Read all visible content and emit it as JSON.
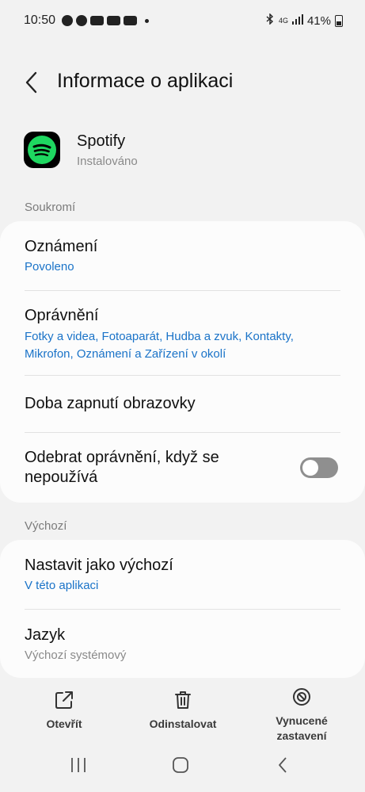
{
  "status_bar": {
    "time": "10:50",
    "battery": "41%",
    "network": "4G"
  },
  "header": {
    "title": "Informace o aplikaci"
  },
  "app": {
    "name": "Spotify",
    "status": "Instalováno"
  },
  "sections": {
    "privacy": {
      "label": "Soukromí",
      "items": [
        {
          "title": "Oznámení",
          "subtitle": "Povoleno"
        },
        {
          "title": "Oprávnění",
          "subtitle_line1": "Fotky a videa, Fotoaparát, Hudba a zvuk, Kontakty,",
          "subtitle_line2": "Mikrofon, Oznámení a Zařízení v okolí"
        },
        {
          "title": "Doba zapnutí obrazovky"
        },
        {
          "title_line1": "Odebrat oprávnění, když se",
          "title_line2": "nepoužívá",
          "toggle_on": false
        }
      ]
    },
    "defaults": {
      "label": "Výchozí",
      "items": [
        {
          "title": "Nastavit jako výchozí",
          "subtitle": "V této aplikaci"
        },
        {
          "title": "Jazyk",
          "subtitle": "Výchozí systémový"
        }
      ]
    }
  },
  "actions": {
    "open": "Otevřít",
    "uninstall": "Odinstalovat",
    "force_stop_line1": "Vynucené",
    "force_stop_line2": "zastavení"
  },
  "colors": {
    "accent": "#1a73c8",
    "spotify_green": "#1ed760"
  }
}
